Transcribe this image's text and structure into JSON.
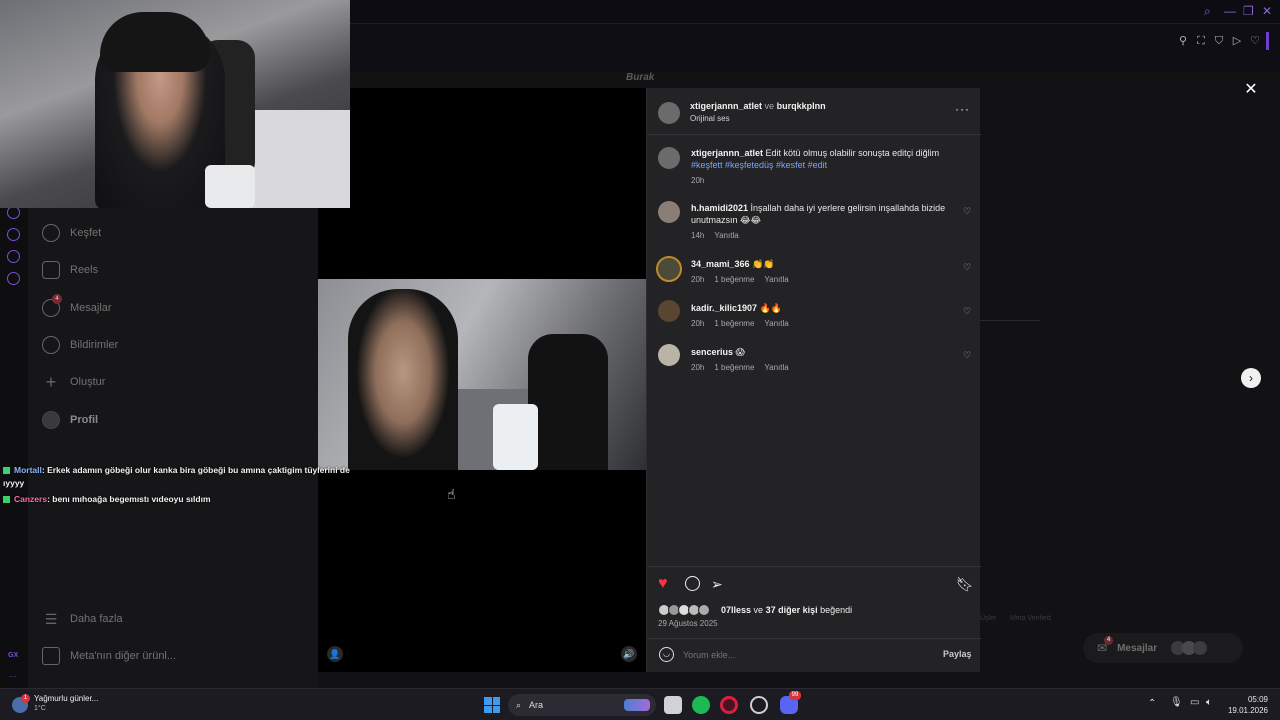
{
  "post": {
    "header_user1": "xtigerjannn_atlet",
    "header_joiner": "ve",
    "header_user2": "burqkkplnn",
    "audio": "Orijinal ses",
    "more_icon": "more-horizontal-icon",
    "caption": {
      "user": "xtigerjannn_atlet",
      "text": "Edit kötü olmuş olabilir sonuşta editçi diğlim",
      "hashtags": "#keşfett #keşfetedüş #kesfet #edit",
      "time": "20h"
    },
    "comments": [
      {
        "user": "h.hamidi2021",
        "text": "İnşallah daha iyi yerlere gelirsin inşallahda bizide unutmazsın 😂😂",
        "time": "14h",
        "likes": "",
        "reply": "Yanıtla"
      },
      {
        "user": "34_mami_366",
        "text": "👏👏",
        "time": "20h",
        "likes": "1 beğenme",
        "reply": "Yanıtla"
      },
      {
        "user": "kadir._kilic1907",
        "text": "🔥🔥",
        "time": "20h",
        "likes": "1 beğenme",
        "reply": "Yanıtla"
      },
      {
        "user": "sencerius",
        "text": "😱",
        "time": "20h",
        "likes": "1 beğenme",
        "reply": "Yanıtla"
      }
    ],
    "liked_by_user": "07lless",
    "liked_mid": "ve",
    "liked_count": "37 diğer kişi",
    "liked_suffix": "beğendi",
    "date": "29 Ağustos 2025",
    "comment_placeholder": "Yorum ekle...",
    "share_label": "Paylaş",
    "colors": {
      "heart": "#ff3040",
      "hashtag": "#7ea3f8"
    }
  },
  "sidebar": {
    "items": [
      {
        "label": "Keşfet",
        "icon": "compass-icon"
      },
      {
        "label": "Reels",
        "icon": "reels-icon"
      },
      {
        "label": "Mesajlar",
        "icon": "messenger-icon",
        "badge": "4"
      },
      {
        "label": "Bildirimler",
        "icon": "heart-icon"
      },
      {
        "label": "Oluştur",
        "icon": "plus-icon"
      },
      {
        "label": "Profil",
        "icon": "avatar"
      }
    ],
    "more": "Daha fazla",
    "meta": "Meta'nın diğer ürünl..."
  },
  "overlay_text": {
    "watermark": "Burak"
  },
  "chat": [
    {
      "user": "Mortall",
      "message": ": Erkek adamın göbeği olur kanka bira göbeği bu amına çaktigim tüylerini de ıyyyy",
      "color": "#8ab4ff"
    },
    {
      "user": "Canzers",
      "message": ": benı mıhoağa begemıstı vıdeoyu sıldım",
      "color": "#ff6b9e"
    }
  ],
  "footer_faint": {
    "links": "Üşler",
    "verified": "Meta Verified"
  },
  "messages_widget": {
    "label": "Mesajlar",
    "badge": "4"
  },
  "left_strip": {
    "label": "GX",
    "more": "···"
  },
  "taskbar": {
    "weather_title": "Yağmurlu günler...",
    "weather_temp": "1°C",
    "weather_badge": "1",
    "search": "Ara",
    "time": "05:09",
    "date": "19.01.2026",
    "discord_badge": "99"
  }
}
